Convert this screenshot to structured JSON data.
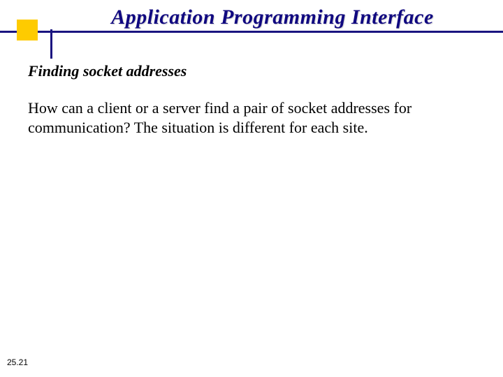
{
  "slide": {
    "title": "Application Programming Interface",
    "subtitle": "Finding socket addresses",
    "body": "How can a client or a server find a pair of socket addresses for communication? The situation is different for each site.",
    "page_number": "25.21"
  }
}
